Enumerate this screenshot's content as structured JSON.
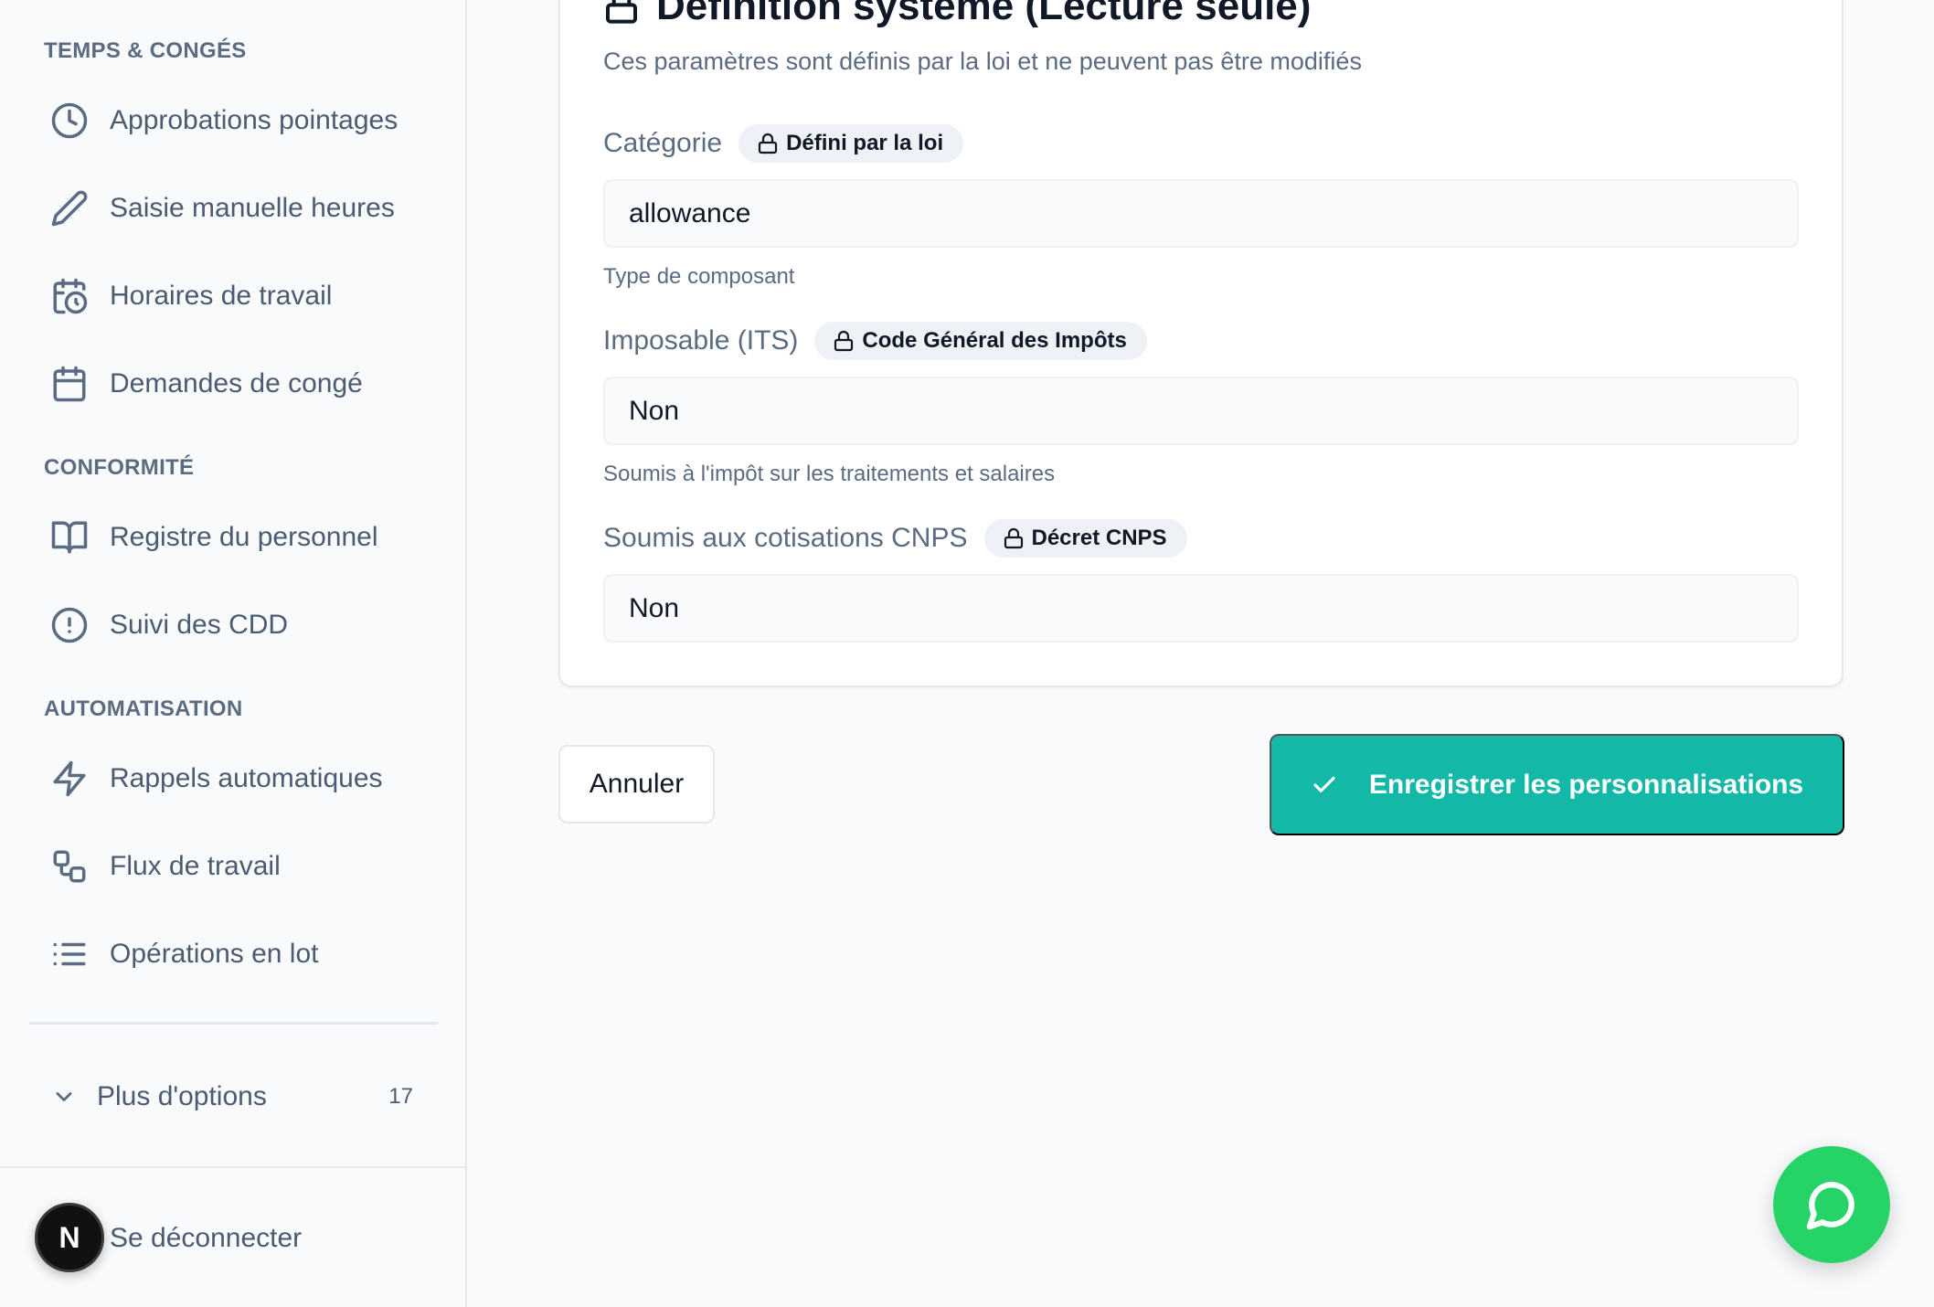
{
  "sidebar": {
    "sections": [
      {
        "heading": "TEMPS & CONGÉS",
        "items": [
          {
            "label": "Approbations pointages",
            "icon": "clock-icon"
          },
          {
            "label": "Saisie manuelle heures",
            "icon": "pencil-icon"
          },
          {
            "label": "Horaires de travail",
            "icon": "calendar-clock-icon"
          },
          {
            "label": "Demandes de congé",
            "icon": "calendar-icon"
          }
        ]
      },
      {
        "heading": "CONFORMITÉ",
        "items": [
          {
            "label": "Registre du personnel",
            "icon": "book-open-icon"
          },
          {
            "label": "Suivi des CDD",
            "icon": "alert-circle-icon"
          }
        ]
      },
      {
        "heading": "AUTOMATISATION",
        "items": [
          {
            "label": "Rappels automatiques",
            "icon": "zap-icon"
          },
          {
            "label": "Flux de travail",
            "icon": "workflow-icon"
          },
          {
            "label": "Opérations en lot",
            "icon": "list-icon"
          }
        ]
      }
    ],
    "more_options": {
      "label": "Plus d'options",
      "count": "17"
    },
    "logout": {
      "label": "Se déconnecter",
      "avatar_letter": "N"
    }
  },
  "card": {
    "title": "Définition système (Lecture seule)",
    "subtitle": "Ces paramètres sont définis par la loi et ne peuvent pas être modifiés",
    "fields": [
      {
        "label": "Catégorie",
        "badge": "Défini par la loi",
        "value": "allowance",
        "help": "Type de composant"
      },
      {
        "label": "Imposable (ITS)",
        "badge": "Code Général des Impôts",
        "value": "Non",
        "help": "Soumis à l'impôt sur les traitements et salaires"
      },
      {
        "label": "Soumis aux cotisations CNPS",
        "badge": "Décret CNPS",
        "value": "Non",
        "help": ""
      }
    ]
  },
  "actions": {
    "cancel_label": "Annuler",
    "save_label": "Enregistrer les personnalisations"
  },
  "colors": {
    "accent": "#14b8a6",
    "chat": "#25d366"
  }
}
